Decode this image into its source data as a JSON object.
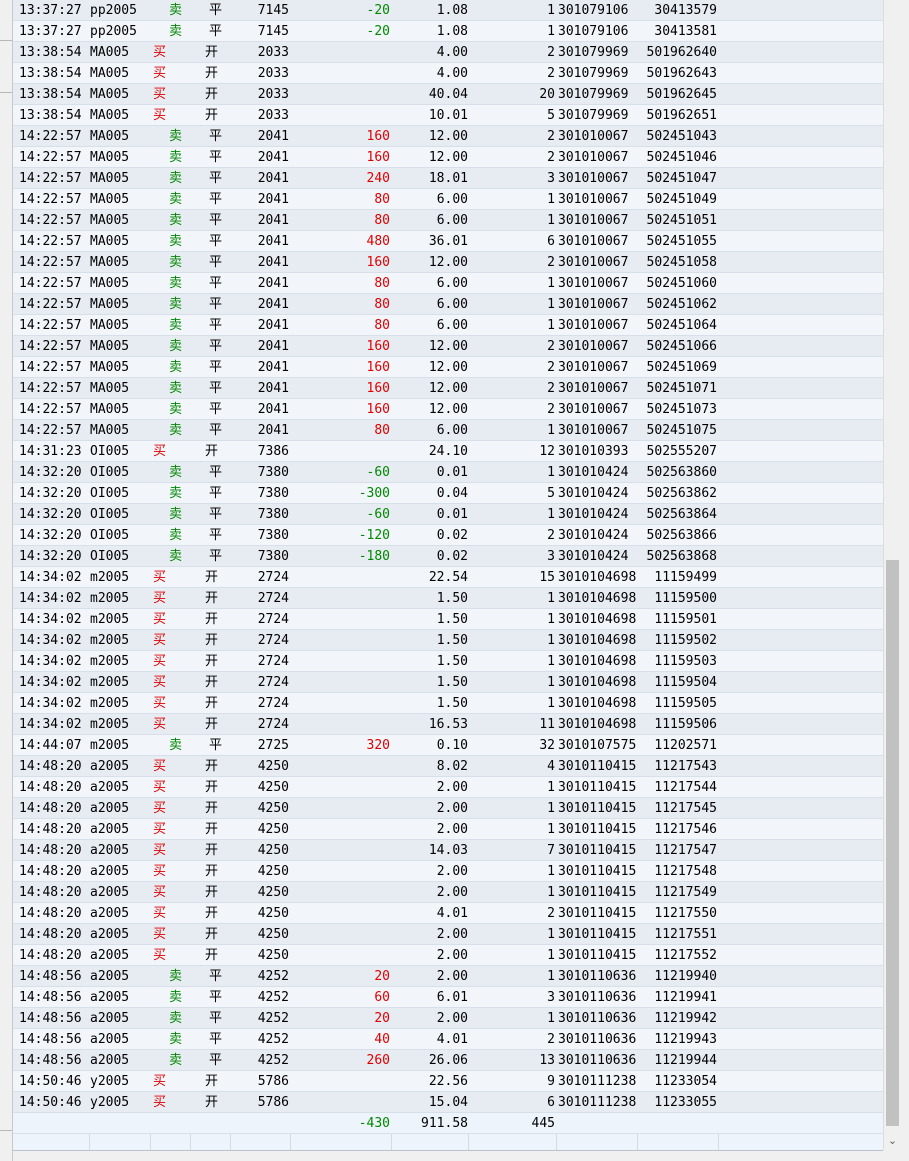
{
  "colors": {
    "buy": "#e00000",
    "sell": "#008800",
    "profit": "#e00000",
    "loss": "#008800"
  },
  "icons": {
    "scroll_down": "chevron-down-icon"
  },
  "rows": [
    {
      "time": "13:37:27",
      "code": "pp2005",
      "dir": "卖",
      "oc": "平",
      "price": "7145",
      "pnl": "-20",
      "fee": "1.08",
      "vol": "1",
      "order": "301079106",
      "trade": "30413579"
    },
    {
      "time": "13:37:27",
      "code": "pp2005",
      "dir": "卖",
      "oc": "平",
      "price": "7145",
      "pnl": "-20",
      "fee": "1.08",
      "vol": "1",
      "order": "301079106",
      "trade": "30413581"
    },
    {
      "time": "13:38:54",
      "code": "MA005",
      "dir": "买",
      "oc": "开",
      "price": "2033",
      "pnl": "",
      "fee": "4.00",
      "vol": "2",
      "order": "301079969",
      "trade": "501962640"
    },
    {
      "time": "13:38:54",
      "code": "MA005",
      "dir": "买",
      "oc": "开",
      "price": "2033",
      "pnl": "",
      "fee": "4.00",
      "vol": "2",
      "order": "301079969",
      "trade": "501962643"
    },
    {
      "time": "13:38:54",
      "code": "MA005",
      "dir": "买",
      "oc": "开",
      "price": "2033",
      "pnl": "",
      "fee": "40.04",
      "vol": "20",
      "order": "301079969",
      "trade": "501962645"
    },
    {
      "time": "13:38:54",
      "code": "MA005",
      "dir": "买",
      "oc": "开",
      "price": "2033",
      "pnl": "",
      "fee": "10.01",
      "vol": "5",
      "order": "301079969",
      "trade": "501962651"
    },
    {
      "time": "14:22:57",
      "code": "MA005",
      "dir": "卖",
      "oc": "平",
      "price": "2041",
      "pnl": "160",
      "fee": "12.00",
      "vol": "2",
      "order": "301010067",
      "trade": "502451043"
    },
    {
      "time": "14:22:57",
      "code": "MA005",
      "dir": "卖",
      "oc": "平",
      "price": "2041",
      "pnl": "160",
      "fee": "12.00",
      "vol": "2",
      "order": "301010067",
      "trade": "502451046"
    },
    {
      "time": "14:22:57",
      "code": "MA005",
      "dir": "卖",
      "oc": "平",
      "price": "2041",
      "pnl": "240",
      "fee": "18.01",
      "vol": "3",
      "order": "301010067",
      "trade": "502451047"
    },
    {
      "time": "14:22:57",
      "code": "MA005",
      "dir": "卖",
      "oc": "平",
      "price": "2041",
      "pnl": "80",
      "fee": "6.00",
      "vol": "1",
      "order": "301010067",
      "trade": "502451049"
    },
    {
      "time": "14:22:57",
      "code": "MA005",
      "dir": "卖",
      "oc": "平",
      "price": "2041",
      "pnl": "80",
      "fee": "6.00",
      "vol": "1",
      "order": "301010067",
      "trade": "502451051"
    },
    {
      "time": "14:22:57",
      "code": "MA005",
      "dir": "卖",
      "oc": "平",
      "price": "2041",
      "pnl": "480",
      "fee": "36.01",
      "vol": "6",
      "order": "301010067",
      "trade": "502451055"
    },
    {
      "time": "14:22:57",
      "code": "MA005",
      "dir": "卖",
      "oc": "平",
      "price": "2041",
      "pnl": "160",
      "fee": "12.00",
      "vol": "2",
      "order": "301010067",
      "trade": "502451058"
    },
    {
      "time": "14:22:57",
      "code": "MA005",
      "dir": "卖",
      "oc": "平",
      "price": "2041",
      "pnl": "80",
      "fee": "6.00",
      "vol": "1",
      "order": "301010067",
      "trade": "502451060"
    },
    {
      "time": "14:22:57",
      "code": "MA005",
      "dir": "卖",
      "oc": "平",
      "price": "2041",
      "pnl": "80",
      "fee": "6.00",
      "vol": "1",
      "order": "301010067",
      "trade": "502451062"
    },
    {
      "time": "14:22:57",
      "code": "MA005",
      "dir": "卖",
      "oc": "平",
      "price": "2041",
      "pnl": "80",
      "fee": "6.00",
      "vol": "1",
      "order": "301010067",
      "trade": "502451064"
    },
    {
      "time": "14:22:57",
      "code": "MA005",
      "dir": "卖",
      "oc": "平",
      "price": "2041",
      "pnl": "160",
      "fee": "12.00",
      "vol": "2",
      "order": "301010067",
      "trade": "502451066"
    },
    {
      "time": "14:22:57",
      "code": "MA005",
      "dir": "卖",
      "oc": "平",
      "price": "2041",
      "pnl": "160",
      "fee": "12.00",
      "vol": "2",
      "order": "301010067",
      "trade": "502451069"
    },
    {
      "time": "14:22:57",
      "code": "MA005",
      "dir": "卖",
      "oc": "平",
      "price": "2041",
      "pnl": "160",
      "fee": "12.00",
      "vol": "2",
      "order": "301010067",
      "trade": "502451071"
    },
    {
      "time": "14:22:57",
      "code": "MA005",
      "dir": "卖",
      "oc": "平",
      "price": "2041",
      "pnl": "160",
      "fee": "12.00",
      "vol": "2",
      "order": "301010067",
      "trade": "502451073"
    },
    {
      "time": "14:22:57",
      "code": "MA005",
      "dir": "卖",
      "oc": "平",
      "price": "2041",
      "pnl": "80",
      "fee": "6.00",
      "vol": "1",
      "order": "301010067",
      "trade": "502451075"
    },
    {
      "time": "14:31:23",
      "code": "OI005",
      "dir": "买",
      "oc": "开",
      "price": "7386",
      "pnl": "",
      "fee": "24.10",
      "vol": "12",
      "order": "301010393",
      "trade": "502555207"
    },
    {
      "time": "14:32:20",
      "code": "OI005",
      "dir": "卖",
      "oc": "平",
      "price": "7380",
      "pnl": "-60",
      "fee": "0.01",
      "vol": "1",
      "order": "301010424",
      "trade": "502563860"
    },
    {
      "time": "14:32:20",
      "code": "OI005",
      "dir": "卖",
      "oc": "平",
      "price": "7380",
      "pnl": "-300",
      "fee": "0.04",
      "vol": "5",
      "order": "301010424",
      "trade": "502563862"
    },
    {
      "time": "14:32:20",
      "code": "OI005",
      "dir": "卖",
      "oc": "平",
      "price": "7380",
      "pnl": "-60",
      "fee": "0.01",
      "vol": "1",
      "order": "301010424",
      "trade": "502563864"
    },
    {
      "time": "14:32:20",
      "code": "OI005",
      "dir": "卖",
      "oc": "平",
      "price": "7380",
      "pnl": "-120",
      "fee": "0.02",
      "vol": "2",
      "order": "301010424",
      "trade": "502563866"
    },
    {
      "time": "14:32:20",
      "code": "OI005",
      "dir": "卖",
      "oc": "平",
      "price": "7380",
      "pnl": "-180",
      "fee": "0.02",
      "vol": "3",
      "order": "301010424",
      "trade": "502563868"
    },
    {
      "time": "14:34:02",
      "code": "m2005",
      "dir": "买",
      "oc": "开",
      "price": "2724",
      "pnl": "",
      "fee": "22.54",
      "vol": "15",
      "order": "3010104698",
      "trade": "11159499"
    },
    {
      "time": "14:34:02",
      "code": "m2005",
      "dir": "买",
      "oc": "开",
      "price": "2724",
      "pnl": "",
      "fee": "1.50",
      "vol": "1",
      "order": "3010104698",
      "trade": "11159500"
    },
    {
      "time": "14:34:02",
      "code": "m2005",
      "dir": "买",
      "oc": "开",
      "price": "2724",
      "pnl": "",
      "fee": "1.50",
      "vol": "1",
      "order": "3010104698",
      "trade": "11159501"
    },
    {
      "time": "14:34:02",
      "code": "m2005",
      "dir": "买",
      "oc": "开",
      "price": "2724",
      "pnl": "",
      "fee": "1.50",
      "vol": "1",
      "order": "3010104698",
      "trade": "11159502"
    },
    {
      "time": "14:34:02",
      "code": "m2005",
      "dir": "买",
      "oc": "开",
      "price": "2724",
      "pnl": "",
      "fee": "1.50",
      "vol": "1",
      "order": "3010104698",
      "trade": "11159503"
    },
    {
      "time": "14:34:02",
      "code": "m2005",
      "dir": "买",
      "oc": "开",
      "price": "2724",
      "pnl": "",
      "fee": "1.50",
      "vol": "1",
      "order": "3010104698",
      "trade": "11159504"
    },
    {
      "time": "14:34:02",
      "code": "m2005",
      "dir": "买",
      "oc": "开",
      "price": "2724",
      "pnl": "",
      "fee": "1.50",
      "vol": "1",
      "order": "3010104698",
      "trade": "11159505"
    },
    {
      "time": "14:34:02",
      "code": "m2005",
      "dir": "买",
      "oc": "开",
      "price": "2724",
      "pnl": "",
      "fee": "16.53",
      "vol": "11",
      "order": "3010104698",
      "trade": "11159506"
    },
    {
      "time": "14:44:07",
      "code": "m2005",
      "dir": "卖",
      "oc": "平",
      "price": "2725",
      "pnl": "320",
      "fee": "0.10",
      "vol": "32",
      "order": "3010107575",
      "trade": "11202571"
    },
    {
      "time": "14:48:20",
      "code": "a2005",
      "dir": "买",
      "oc": "开",
      "price": "4250",
      "pnl": "",
      "fee": "8.02",
      "vol": "4",
      "order": "3010110415",
      "trade": "11217543"
    },
    {
      "time": "14:48:20",
      "code": "a2005",
      "dir": "买",
      "oc": "开",
      "price": "4250",
      "pnl": "",
      "fee": "2.00",
      "vol": "1",
      "order": "3010110415",
      "trade": "11217544"
    },
    {
      "time": "14:48:20",
      "code": "a2005",
      "dir": "买",
      "oc": "开",
      "price": "4250",
      "pnl": "",
      "fee": "2.00",
      "vol": "1",
      "order": "3010110415",
      "trade": "11217545"
    },
    {
      "time": "14:48:20",
      "code": "a2005",
      "dir": "买",
      "oc": "开",
      "price": "4250",
      "pnl": "",
      "fee": "2.00",
      "vol": "1",
      "order": "3010110415",
      "trade": "11217546"
    },
    {
      "time": "14:48:20",
      "code": "a2005",
      "dir": "买",
      "oc": "开",
      "price": "4250",
      "pnl": "",
      "fee": "14.03",
      "vol": "7",
      "order": "3010110415",
      "trade": "11217547"
    },
    {
      "time": "14:48:20",
      "code": "a2005",
      "dir": "买",
      "oc": "开",
      "price": "4250",
      "pnl": "",
      "fee": "2.00",
      "vol": "1",
      "order": "3010110415",
      "trade": "11217548"
    },
    {
      "time": "14:48:20",
      "code": "a2005",
      "dir": "买",
      "oc": "开",
      "price": "4250",
      "pnl": "",
      "fee": "2.00",
      "vol": "1",
      "order": "3010110415",
      "trade": "11217549"
    },
    {
      "time": "14:48:20",
      "code": "a2005",
      "dir": "买",
      "oc": "开",
      "price": "4250",
      "pnl": "",
      "fee": "4.01",
      "vol": "2",
      "order": "3010110415",
      "trade": "11217550"
    },
    {
      "time": "14:48:20",
      "code": "a2005",
      "dir": "买",
      "oc": "开",
      "price": "4250",
      "pnl": "",
      "fee": "2.00",
      "vol": "1",
      "order": "3010110415",
      "trade": "11217551"
    },
    {
      "time": "14:48:20",
      "code": "a2005",
      "dir": "买",
      "oc": "开",
      "price": "4250",
      "pnl": "",
      "fee": "2.00",
      "vol": "1",
      "order": "3010110415",
      "trade": "11217552"
    },
    {
      "time": "14:48:56",
      "code": "a2005",
      "dir": "卖",
      "oc": "平",
      "price": "4252",
      "pnl": "20",
      "fee": "2.00",
      "vol": "1",
      "order": "3010110636",
      "trade": "11219940"
    },
    {
      "time": "14:48:56",
      "code": "a2005",
      "dir": "卖",
      "oc": "平",
      "price": "4252",
      "pnl": "60",
      "fee": "6.01",
      "vol": "3",
      "order": "3010110636",
      "trade": "11219941"
    },
    {
      "time": "14:48:56",
      "code": "a2005",
      "dir": "卖",
      "oc": "平",
      "price": "4252",
      "pnl": "20",
      "fee": "2.00",
      "vol": "1",
      "order": "3010110636",
      "trade": "11219942"
    },
    {
      "time": "14:48:56",
      "code": "a2005",
      "dir": "卖",
      "oc": "平",
      "price": "4252",
      "pnl": "40",
      "fee": "4.01",
      "vol": "2",
      "order": "3010110636",
      "trade": "11219943"
    },
    {
      "time": "14:48:56",
      "code": "a2005",
      "dir": "卖",
      "oc": "平",
      "price": "4252",
      "pnl": "260",
      "fee": "26.06",
      "vol": "13",
      "order": "3010110636",
      "trade": "11219944"
    },
    {
      "time": "14:50:46",
      "code": "y2005",
      "dir": "买",
      "oc": "开",
      "price": "5786",
      "pnl": "",
      "fee": "22.56",
      "vol": "9",
      "order": "3010111238",
      "trade": "11233054"
    },
    {
      "time": "14:50:46",
      "code": "y2005",
      "dir": "买",
      "oc": "开",
      "price": "5786",
      "pnl": "",
      "fee": "15.04",
      "vol": "6",
      "order": "3010111238",
      "trade": "11233055"
    }
  ],
  "totals": {
    "pnl": "-430",
    "fee": "911.58",
    "vol": "445"
  }
}
